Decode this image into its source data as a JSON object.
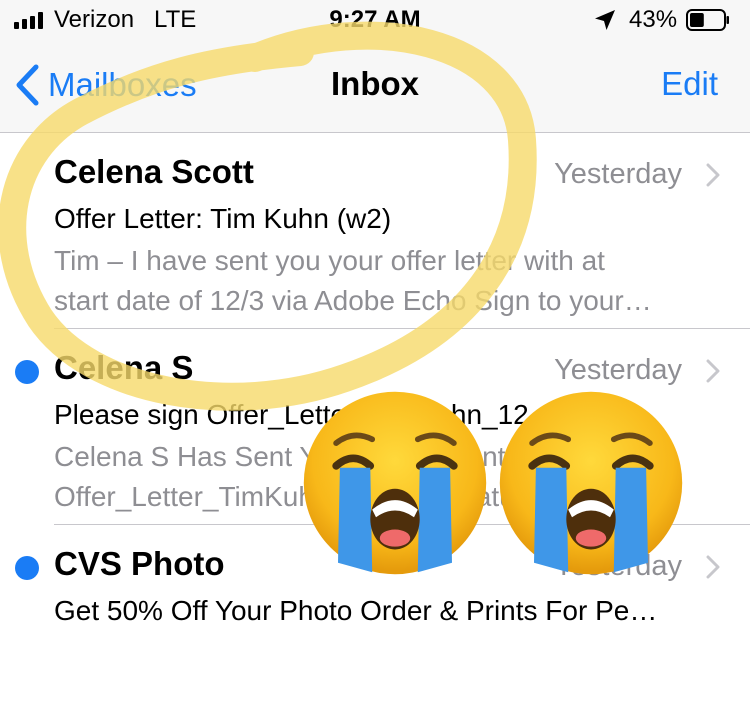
{
  "status_bar": {
    "carrier": "Verizon",
    "network": "LTE",
    "time": "9:27 AM",
    "battery_percent": "43%",
    "battery_level": 0.43,
    "icons": [
      "signal-bars-icon",
      "location-arrow-icon",
      "battery-icon"
    ]
  },
  "nav": {
    "back_label": "Mailboxes",
    "title": "Inbox",
    "edit_label": "Edit",
    "accent_color": "#1a7cf5"
  },
  "messages": [
    {
      "sender": "Celena Scott",
      "date": "Yesterday",
      "subject": "Offer Letter: Tim Kuhn (w2)",
      "preview_line1": "Tim – I have sent you your offer letter with at",
      "preview_line2": "start date of 12/3 via Adobe Echo Sign to your…",
      "unread": false
    },
    {
      "sender": "Celena S",
      "date": "Yesterday",
      "subject": "Please sign Offer_Letter_TimKuhn_12",
      "preview_line1": "Celena S Has Sent You A Document",
      "preview_line2": "Offer_Letter_TimKuhn_12 for signature",
      "unread": true
    },
    {
      "sender": "CVS Photo",
      "date": "Yesterday",
      "subject": "Get 50% Off Your Photo Order & Prints For Pe…",
      "unread": true
    }
  ],
  "overlays": {
    "highlight_color": "#f6d96a",
    "emoji": "loudly-crying-face"
  }
}
